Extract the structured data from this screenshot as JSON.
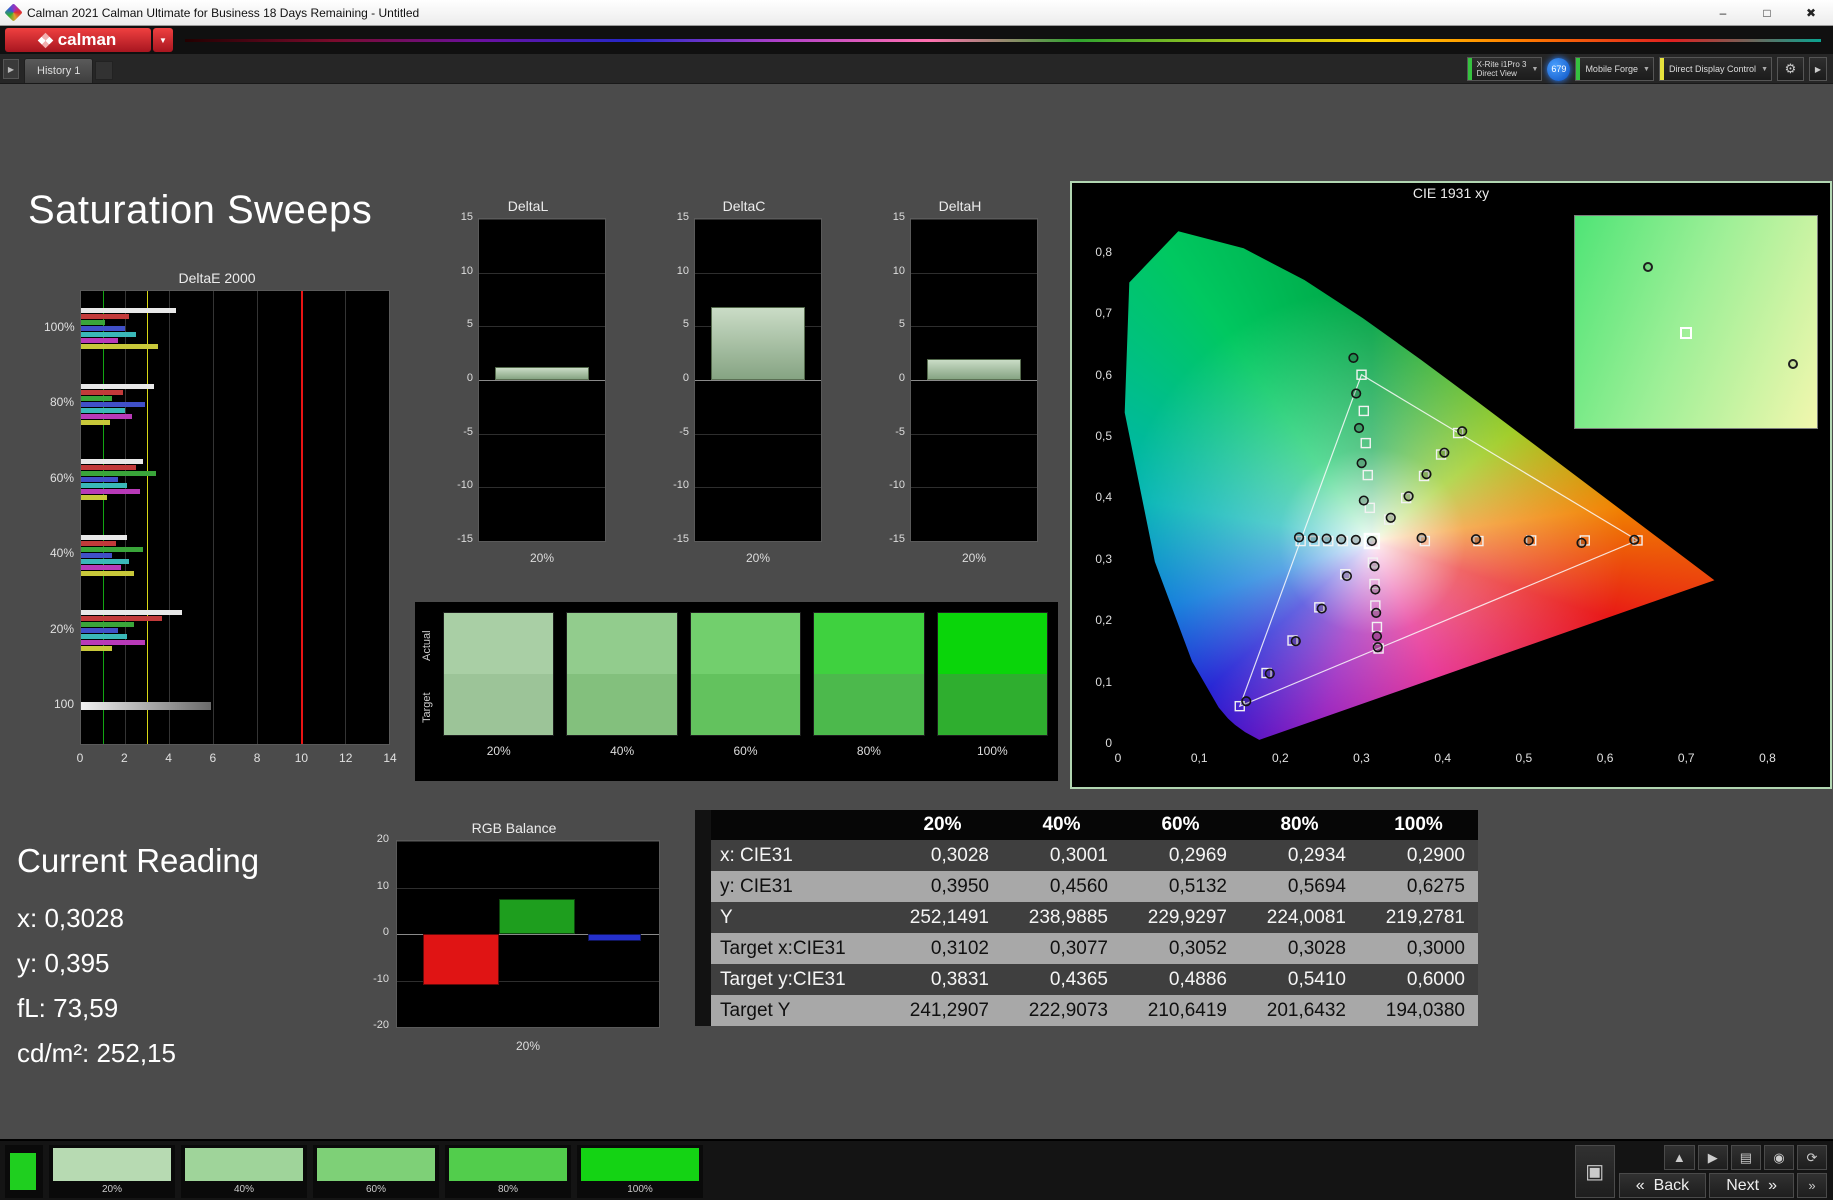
{
  "window": {
    "title": "Calman 2021 Calman Ultimate for Business 18 Days Remaining  - Untitled",
    "controls": {
      "minimize": "–",
      "maximize": "□",
      "close": "✖"
    }
  },
  "brand": {
    "logo_text": "calman",
    "caret": "▼"
  },
  "tab_bar": {
    "history_tab": "History 1",
    "expander": "▶"
  },
  "meter_bar": {
    "meter_button": {
      "line1": "X-Rite i1Pro 3",
      "line2": "Direct View",
      "caret": "▼",
      "stripe_color": "#35c13f"
    },
    "badge": "679",
    "source_button": {
      "label": "Mobile Forge",
      "caret": "▼",
      "stripe_color": "#35c13f"
    },
    "display_button": {
      "label": "Direct Display Control",
      "caret": "▼",
      "stripe_color": "#e6e23c"
    },
    "gear": "⚙",
    "collapse": "▶"
  },
  "page": {
    "title": "Saturation Sweeps"
  },
  "current_reading": {
    "title": "Current Reading",
    "lines": [
      "x: 0,3028",
      "y: 0,395",
      "fL: 73,59",
      "cd/m²: 252,15"
    ]
  },
  "patches": {
    "row_labels": [
      "Actual",
      "Target"
    ],
    "columns": [
      {
        "label": "20%",
        "actual": "#a9cfa5",
        "target": "#9cc498"
      },
      {
        "label": "40%",
        "actual": "#92cc8d",
        "target": "#83c07d"
      },
      {
        "label": "60%",
        "actual": "#72cf6d",
        "target": "#63c25e"
      },
      {
        "label": "80%",
        "actual": "#3fd13f",
        "target": "#4cb94c"
      },
      {
        "label": "100%",
        "actual": "#0ad50a",
        "target": "#2fae2f"
      }
    ]
  },
  "results_table": {
    "columns": [
      "20%",
      "40%",
      "60%",
      "80%",
      "100%"
    ],
    "rows": [
      {
        "label": "x: CIE31",
        "shade": "dark",
        "values": [
          "0,3028",
          "0,3001",
          "0,2969",
          "0,2934",
          "0,2900"
        ]
      },
      {
        "label": "y: CIE31",
        "shade": "light",
        "values": [
          "0,3950",
          "0,4560",
          "0,5132",
          "0,5694",
          "0,6275"
        ]
      },
      {
        "label": "Y",
        "shade": "dark",
        "values": [
          "252,1491",
          "238,9885",
          "229,9297",
          "224,0081",
          "219,2781"
        ]
      },
      {
        "label": "Target x:CIE31",
        "shade": "light",
        "values": [
          "0,3102",
          "0,3077",
          "0,3052",
          "0,3028",
          "0,3000"
        ]
      },
      {
        "label": "Target y:CIE31",
        "shade": "dark",
        "values": [
          "0,3831",
          "0,4365",
          "0,4886",
          "0,5410",
          "0,6000"
        ]
      },
      {
        "label": "Target Y",
        "shade": "light",
        "values": [
          "241,2907",
          "222,9073",
          "210,6419",
          "201,6432",
          "194,0380"
        ]
      }
    ]
  },
  "bottom_bar": {
    "thumbnails": [
      {
        "label": "20%",
        "color": "#b7dab2"
      },
      {
        "label": "40%",
        "color": "#9fd49a"
      },
      {
        "label": "60%",
        "color": "#7ed077"
      },
      {
        "label": "80%",
        "color": "#52cd4c"
      },
      {
        "label": "100%",
        "color": "#14d314"
      }
    ],
    "preview_color": "#1fcf1f",
    "buttons": {
      "back": "Back",
      "next": "Next"
    },
    "icons": {
      "up": "▲",
      "play": "▶",
      "save": "▤",
      "eye": "◉",
      "refresh": "⟳",
      "back_arrow": "«",
      "next_arrow": "»",
      "fast_forward": "»",
      "monitor": "▣"
    }
  },
  "chart_data": [
    {
      "id": "deltae2000",
      "type": "bar",
      "orientation": "horizontal",
      "title": "DeltaE 2000",
      "xlim": [
        0,
        14
      ],
      "xticks": [
        0,
        2,
        4,
        6,
        8,
        10,
        12,
        14
      ],
      "reference_lines": [
        {
          "value": 1,
          "color": "#12a512"
        },
        {
          "value": 3,
          "color": "#d8d814"
        },
        {
          "value": 10,
          "color": "#e81414"
        }
      ],
      "groups": [
        {
          "label": "100%",
          "bars": [
            {
              "color": "#e8e8e8",
              "value": 4.3
            },
            {
              "color": "#c23a3a",
              "value": 2.2
            },
            {
              "color": "#3aa53a",
              "value": 1.1
            },
            {
              "color": "#4050c8",
              "value": 2.0
            },
            {
              "color": "#3ab8b8",
              "value": 2.5
            },
            {
              "color": "#b83ab8",
              "value": 1.7
            },
            {
              "color": "#c8c83a",
              "value": 3.5
            }
          ]
        },
        {
          "label": "80%",
          "bars": [
            {
              "color": "#e8e8e8",
              "value": 3.3
            },
            {
              "color": "#c23a3a",
              "value": 1.9
            },
            {
              "color": "#3aa53a",
              "value": 1.4
            },
            {
              "color": "#4050c8",
              "value": 2.9
            },
            {
              "color": "#3ab8b8",
              "value": 2.0
            },
            {
              "color": "#b83ab8",
              "value": 2.3
            },
            {
              "color": "#c8c83a",
              "value": 1.3
            }
          ]
        },
        {
          "label": "60%",
          "bars": [
            {
              "color": "#e8e8e8",
              "value": 2.8
            },
            {
              "color": "#c23a3a",
              "value": 2.5
            },
            {
              "color": "#3aa53a",
              "value": 3.4
            },
            {
              "color": "#4050c8",
              "value": 1.7
            },
            {
              "color": "#3ab8b8",
              "value": 2.1
            },
            {
              "color": "#b83ab8",
              "value": 2.7
            },
            {
              "color": "#c8c83a",
              "value": 1.2
            }
          ]
        },
        {
          "label": "40%",
          "bars": [
            {
              "color": "#e8e8e8",
              "value": 2.1
            },
            {
              "color": "#c23a3a",
              "value": 1.6
            },
            {
              "color": "#3aa53a",
              "value": 2.8
            },
            {
              "color": "#4050c8",
              "value": 1.4
            },
            {
              "color": "#3ab8b8",
              "value": 2.2
            },
            {
              "color": "#b83ab8",
              "value": 1.8
            },
            {
              "color": "#c8c83a",
              "value": 2.4
            }
          ]
        },
        {
          "label": "20%",
          "bars": [
            {
              "color": "#e8e8e8",
              "value": 4.6
            },
            {
              "color": "#c23a3a",
              "value": 3.7
            },
            {
              "color": "#3aa53a",
              "value": 2.4
            },
            {
              "color": "#4050c8",
              "value": 1.7
            },
            {
              "color": "#3ab8b8",
              "value": 2.1
            },
            {
              "color": "#b83ab8",
              "value": 2.9
            },
            {
              "color": "#c8c83a",
              "value": 1.4
            }
          ]
        },
        {
          "label": "100",
          "bars": [
            {
              "color": "#f0f0f0",
              "color2": "#6a6a6a",
              "value": 5.9
            }
          ]
        }
      ]
    },
    {
      "id": "deltaL",
      "type": "bar",
      "title": "DeltaL",
      "ylim": [
        -15,
        15
      ],
      "yticks": [
        15,
        10,
        5,
        0,
        -5,
        -10,
        -15
      ],
      "categories": [
        "20%"
      ],
      "values": [
        1.2
      ],
      "bar_colors": [
        "#cadcc6",
        "#86a483"
      ]
    },
    {
      "id": "deltaC",
      "type": "bar",
      "title": "DeltaC",
      "ylim": [
        -15,
        15
      ],
      "yticks": [
        15,
        10,
        5,
        0,
        -5,
        -10,
        -15
      ],
      "categories": [
        "20%"
      ],
      "values": [
        6.8
      ],
      "bar_colors": [
        "#cadcc6",
        "#86a483"
      ]
    },
    {
      "id": "deltaH",
      "type": "bar",
      "title": "DeltaH",
      "ylim": [
        -15,
        15
      ],
      "yticks": [
        15,
        10,
        5,
        0,
        -5,
        -10,
        -15
      ],
      "categories": [
        "20%"
      ],
      "values": [
        2.0
      ],
      "bar_colors": [
        "#cadcc6",
        "#86a483"
      ]
    },
    {
      "id": "rgbbalance",
      "type": "bar",
      "title": "RGB Balance",
      "ylim": [
        -20,
        20
      ],
      "yticks": [
        20,
        10,
        0,
        -10,
        -20
      ],
      "categories": [
        "20%"
      ],
      "series": [
        {
          "name": "Red",
          "value": -11,
          "color": "#e01414"
        },
        {
          "name": "Green",
          "value": 7.5,
          "color": "#1e9e1e"
        },
        {
          "name": "Blue",
          "value": -1.5,
          "color": "#2430cc"
        }
      ]
    },
    {
      "id": "cie1931",
      "type": "scatter",
      "title": "CIE 1931 xy",
      "xlim": [
        0,
        0.85
      ],
      "ylim": [
        0,
        0.87
      ],
      "x_ticks": [
        {
          "v": 0,
          "label": "0"
        },
        {
          "v": 0.1,
          "label": "0,1"
        },
        {
          "v": 0.2,
          "label": "0,2"
        },
        {
          "v": 0.3,
          "label": "0,3"
        },
        {
          "v": 0.4,
          "label": "0,4"
        },
        {
          "v": 0.5,
          "label": "0,5"
        },
        {
          "v": 0.6,
          "label": "0,6"
        },
        {
          "v": 0.7,
          "label": "0,7"
        },
        {
          "v": 0.8,
          "label": "0,8"
        }
      ],
      "y_ticks": [
        {
          "v": 0,
          "label": "0"
        },
        {
          "v": 0.1,
          "label": "0,1"
        },
        {
          "v": 0.2,
          "label": "0,2"
        },
        {
          "v": 0.3,
          "label": "0,3"
        },
        {
          "v": 0.4,
          "label": "0,4"
        },
        {
          "v": 0.5,
          "label": "0,5"
        },
        {
          "v": 0.6,
          "label": "0,6"
        },
        {
          "v": 0.7,
          "label": "0,7"
        },
        {
          "v": 0.8,
          "label": "0,8"
        }
      ],
      "locus": [
        [
          0.1741,
          0.005
        ],
        [
          0.1566,
          0.0177
        ],
        [
          0.144,
          0.0297
        ],
        [
          0.1355,
          0.0399
        ],
        [
          0.1241,
          0.0578
        ],
        [
          0.0913,
          0.1327
        ],
        [
          0.0454,
          0.295
        ],
        [
          0.0082,
          0.5384
        ],
        [
          0.0139,
          0.7502
        ],
        [
          0.0743,
          0.8338
        ],
        [
          0.1547,
          0.8059
        ],
        [
          0.2296,
          0.7543
        ],
        [
          0.3016,
          0.6923
        ],
        [
          0.3731,
          0.6245
        ],
        [
          0.4441,
          0.5547
        ],
        [
          0.5125,
          0.4866
        ],
        [
          0.5752,
          0.4242
        ],
        [
          0.627,
          0.3725
        ],
        [
          0.6915,
          0.3083
        ],
        [
          0.7347,
          0.2653
        ]
      ],
      "gamut_triangle": [
        [
          0.64,
          0.33
        ],
        [
          0.3,
          0.6
        ],
        [
          0.15,
          0.06
        ]
      ],
      "white_point": [
        0.3127,
        0.329
      ],
      "highlight_target": [
        0.3127,
        0.329
      ],
      "targets": [
        [
          0.3102,
          0.3831
        ],
        [
          0.3077,
          0.4365
        ],
        [
          0.3052,
          0.4886
        ],
        [
          0.3028,
          0.541
        ],
        [
          0.3,
          0.6
        ],
        [
          0.378,
          0.329
        ],
        [
          0.444,
          0.329
        ],
        [
          0.509,
          0.33
        ],
        [
          0.575,
          0.33
        ],
        [
          0.64,
          0.33
        ],
        [
          0.28,
          0.275
        ],
        [
          0.248,
          0.221
        ],
        [
          0.215,
          0.167
        ],
        [
          0.183,
          0.114
        ],
        [
          0.15,
          0.06
        ],
        [
          0.334,
          0.364
        ],
        [
          0.355,
          0.399
        ],
        [
          0.377,
          0.435
        ],
        [
          0.398,
          0.47
        ],
        [
          0.419,
          0.505
        ],
        [
          0.295,
          0.329
        ],
        [
          0.277,
          0.329
        ],
        [
          0.259,
          0.329
        ],
        [
          0.242,
          0.329
        ],
        [
          0.225,
          0.329
        ],
        [
          0.314,
          0.294
        ],
        [
          0.316,
          0.259
        ],
        [
          0.317,
          0.224
        ],
        [
          0.319,
          0.189
        ],
        [
          0.321,
          0.154
        ]
      ],
      "measured": [
        [
          0.3028,
          0.395
        ],
        [
          0.3001,
          0.456
        ],
        [
          0.2969,
          0.5132
        ],
        [
          0.2934,
          0.5694
        ],
        [
          0.29,
          0.6275
        ],
        [
          0.374,
          0.334
        ],
        [
          0.441,
          0.332
        ],
        [
          0.506,
          0.33
        ],
        [
          0.571,
          0.326
        ],
        [
          0.636,
          0.331
        ],
        [
          0.282,
          0.272
        ],
        [
          0.251,
          0.219
        ],
        [
          0.219,
          0.166
        ],
        [
          0.187,
          0.113
        ],
        [
          0.158,
          0.068
        ],
        [
          0.336,
          0.367
        ],
        [
          0.358,
          0.402
        ],
        [
          0.38,
          0.438
        ],
        [
          0.402,
          0.473
        ],
        [
          0.424,
          0.508
        ],
        [
          0.293,
          0.331
        ],
        [
          0.275,
          0.332
        ],
        [
          0.257,
          0.333
        ],
        [
          0.24,
          0.334
        ],
        [
          0.223,
          0.335
        ],
        [
          0.316,
          0.288
        ],
        [
          0.317,
          0.25
        ],
        [
          0.318,
          0.212
        ],
        [
          0.319,
          0.174
        ],
        [
          0.32,
          0.156
        ],
        [
          0.3127,
          0.329
        ]
      ],
      "inset": {
        "points": [
          {
            "type": "circle",
            "x": 30,
            "y": 24
          },
          {
            "type": "circle",
            "x": 90,
            "y": 70
          },
          {
            "type": "square",
            "x": 46,
            "y": 55
          }
        ]
      }
    }
  ]
}
